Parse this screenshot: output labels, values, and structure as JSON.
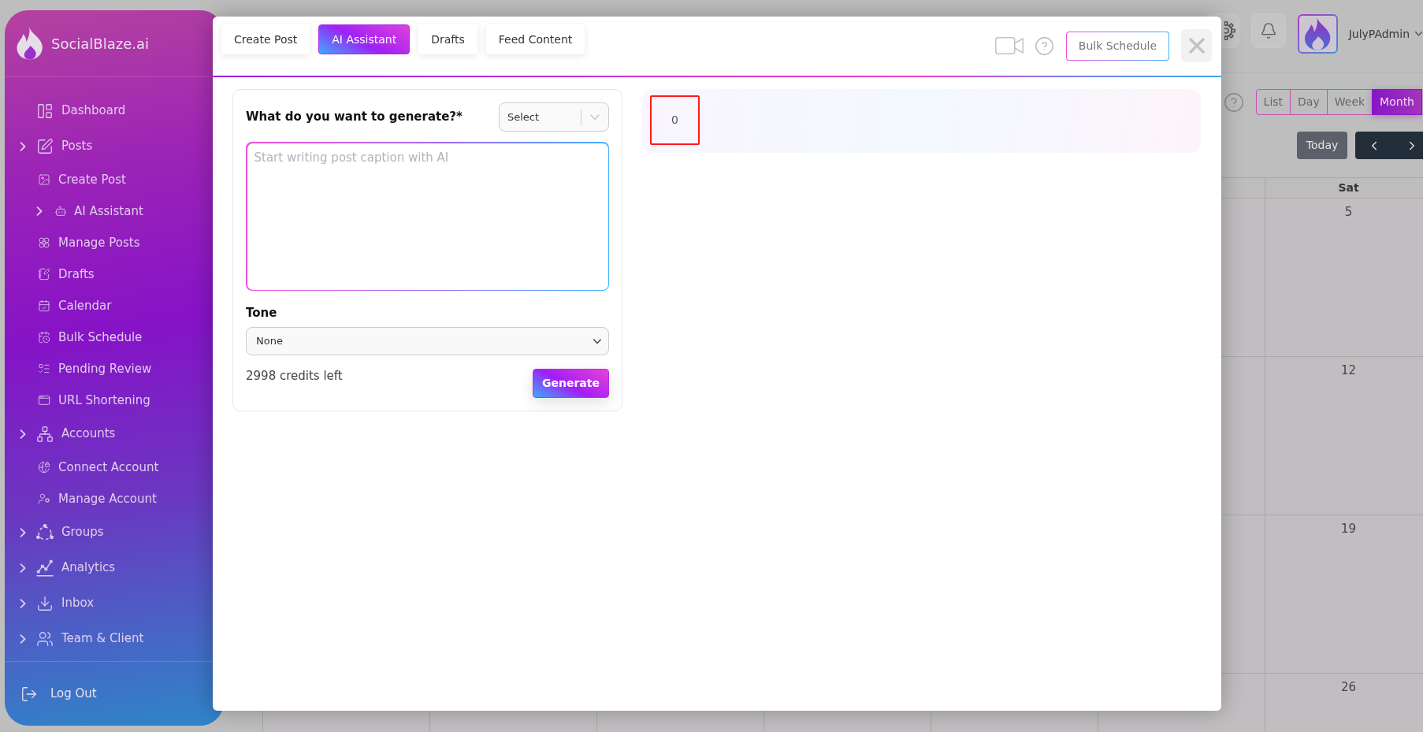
{
  "sidebar": {
    "brand": "SocialBlaze.ai",
    "items": [
      {
        "label": "Dashboard",
        "kind": "link"
      },
      {
        "label": "Posts",
        "kind": "group",
        "children": [
          {
            "label": "Create Post",
            "kind": "link"
          },
          {
            "label": "AI Assistant",
            "kind": "group"
          },
          {
            "label": "Manage Posts",
            "kind": "link"
          },
          {
            "label": "Drafts",
            "kind": "link"
          },
          {
            "label": "Calendar",
            "kind": "link"
          },
          {
            "label": "Bulk Schedule",
            "kind": "link"
          },
          {
            "label": "Pending Review",
            "kind": "link"
          },
          {
            "label": "URL Shortening",
            "kind": "link"
          }
        ]
      },
      {
        "label": "Accounts",
        "kind": "group",
        "children": [
          {
            "label": "Connect Account",
            "kind": "link"
          },
          {
            "label": "Manage Account",
            "kind": "link"
          }
        ]
      },
      {
        "label": "Groups",
        "kind": "group"
      },
      {
        "label": "Analytics",
        "kind": "group"
      },
      {
        "label": "Inbox",
        "kind": "group"
      },
      {
        "label": "Team & Client",
        "kind": "group"
      }
    ],
    "logout": "Log Out"
  },
  "header": {
    "user_name": "JulyPAdmin"
  },
  "calendar": {
    "views": [
      {
        "label": "List",
        "selected": false
      },
      {
        "label": "Day",
        "selected": false
      },
      {
        "label": "Week",
        "selected": false
      },
      {
        "label": "Month",
        "selected": true
      }
    ],
    "today_button": "Today",
    "weekday": "Sat",
    "dates": [
      "5",
      "12",
      "19",
      "26"
    ]
  },
  "modal": {
    "tabs": [
      {
        "label": "Create Post",
        "selected": false
      },
      {
        "label": "AI Assistant",
        "selected": true
      },
      {
        "label": "Drafts",
        "selected": false
      },
      {
        "label": "Feed Content",
        "selected": false
      }
    ],
    "bulk_schedule_button": "Bulk Schedule",
    "generator": {
      "question": "What do you want to generate?*",
      "type_select": {
        "placeholder": "Select"
      },
      "caption": {
        "placeholder": "Start writing post caption with AI"
      },
      "tone_label": "Tone",
      "tone_select": {
        "value": "None"
      },
      "credits": "2998 credits left",
      "generate_button": "Generate"
    },
    "counter": "0"
  }
}
